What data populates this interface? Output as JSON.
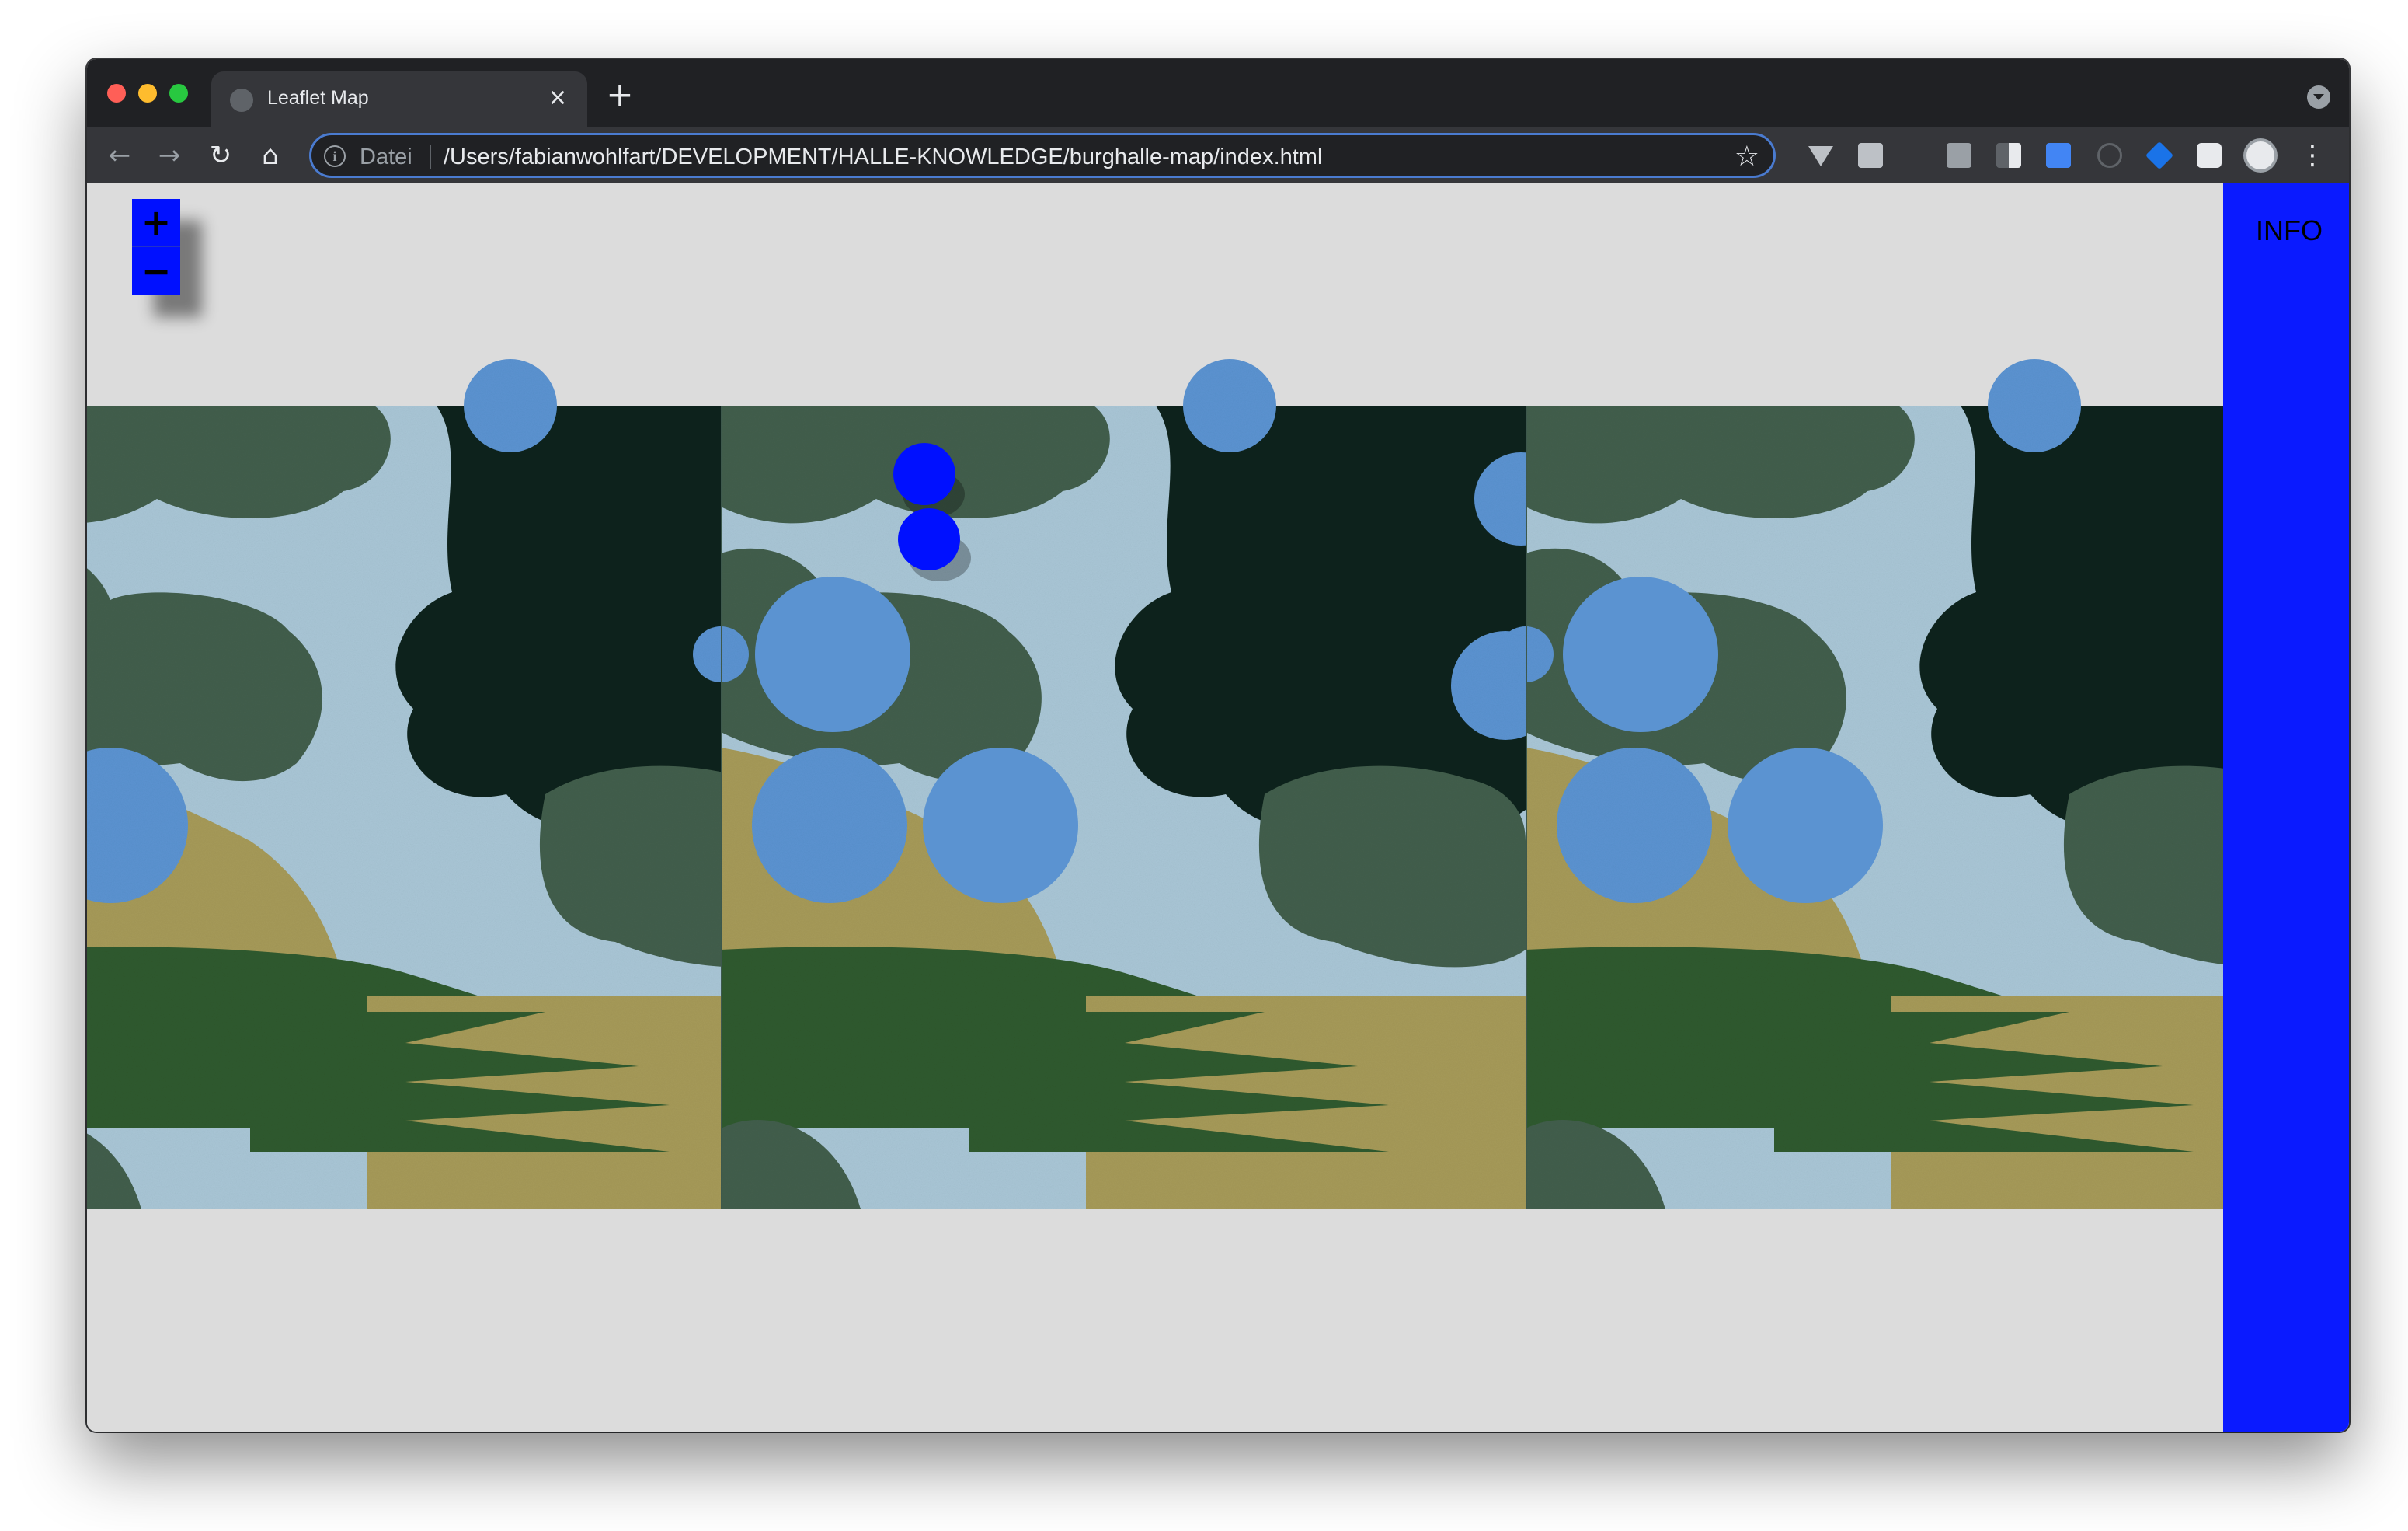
{
  "browser": {
    "tab": {
      "title": "Leaflet Map",
      "close_glyph": "×",
      "favicon_icon": "globe-icon"
    },
    "new_tab_glyph": "+",
    "toolbar": {
      "back_glyph": "←",
      "forward_glyph": "→",
      "reload_glyph": "↻",
      "home_glyph": "⌂",
      "address": {
        "info_glyph": "i",
        "scheme_label": "Datei",
        "url": "/Users/fabianwohlfart/DEVELOPMENT/HALLE-KNOWLEDGE/burghalle-map/index.html",
        "star_glyph": "☆"
      },
      "extensions": [
        "vue-devtools-icon",
        "google-icon",
        "code-icon",
        "contrast-icon",
        "translate-icon",
        "globe-icon",
        "tag-icon",
        "puzzle-icon"
      ],
      "menu_glyph": "⋮"
    }
  },
  "map": {
    "zoom_in_label": "+",
    "zoom_out_label": "−",
    "info_label": "INFO",
    "marker_count": 2,
    "colors": {
      "accent": "#0a1aff",
      "background": "#dcdcdc",
      "water": "#a9c6d6",
      "water_circle": "#5b93d1",
      "forest_dark": "#0e231c",
      "forest_mid": "#425e4c",
      "field": "#a69a59",
      "grass": "#2f5a2e"
    }
  }
}
